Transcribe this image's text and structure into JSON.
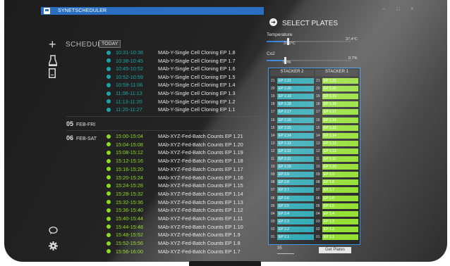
{
  "window": {
    "title": "SYNETSCHEDULER",
    "controls": [
      "–",
      "□",
      "×"
    ]
  },
  "schedule": {
    "heading": "SCHEDULE",
    "today_label": "TODAY"
  },
  "colors": {
    "teal": "#1aa6a6",
    "green": "#8ddc1f",
    "blue": "#2a6fc2",
    "teal_cell": "#1fa3b0",
    "green_cell": "#8ede2a"
  },
  "icons": [
    "plus-icon",
    "flask-icon",
    "tablet-icon",
    "chat-icon",
    "gear-icon"
  ],
  "rows_top": [
    {
      "time": "10:31-10:38",
      "name": "MAb-Y-Single Cell Cloning  EP 1.8"
    },
    {
      "time": "10:38-10:45",
      "name": "MAb-Y-Single Cell Cloning  EP 1.7"
    },
    {
      "time": "10:45-10:52",
      "name": "MAb-Y-Single Cell Cloning  EP 1.6"
    },
    {
      "time": "10:52-10:59",
      "name": "MAb-Y-Single Cell Cloning  EP 1.5"
    },
    {
      "time": "10:59-11:06",
      "name": "MAb-Y-Single Cell Cloning  EP 1.4"
    },
    {
      "time": "11:06-11:13",
      "name": "MAb-Y-Single Cell Cloning  EP 1.3"
    },
    {
      "time": "11:13-11:20",
      "name": "MAb-Y-Single Cell Cloning  EP 1.2"
    },
    {
      "time": "11:20-11:27",
      "name": "MAb-Y-Single Cell Cloning  EP 1.1"
    }
  ],
  "days": [
    {
      "num": "05",
      "label": "FEB-FRI"
    },
    {
      "num": "06",
      "label": "FEB-SAT"
    }
  ],
  "rows_bottom": [
    {
      "time": "15:00-15:04",
      "name": "MAb-XYZ-Fed-Batch Counts  EP 1.21"
    },
    {
      "time": "15:04-15:08",
      "name": "MAb-XYZ-Fed-Batch Counts  EP 1.20"
    },
    {
      "time": "15:08-15:12",
      "name": "MAb-XYZ-Fed-Batch Counts  EP 1.19"
    },
    {
      "time": "15:12-15:16",
      "name": "MAb-XYZ-Fed-Batch Counts  EP 1.18"
    },
    {
      "time": "15:16-15:20",
      "name": "MAb-XYZ-Fed-Batch Counts  EP 1.17"
    },
    {
      "time": "15:20-15:24",
      "name": "MAb-XYZ-Fed-Batch Counts  EP 1.16"
    },
    {
      "time": "15:24-15:28",
      "name": "MAb-XYZ-Fed-Batch Counts  EP 1.15"
    },
    {
      "time": "15:28-15:32",
      "name": "MAb-XYZ-Fed-Batch Counts  EP 1.14"
    },
    {
      "time": "15:32-15:36",
      "name": "MAb-XYZ-Fed-Batch Counts  EP 1.13"
    },
    {
      "time": "15:36-15:40",
      "name": "MAb-XYZ-Fed-Batch Counts  EP 1.12"
    },
    {
      "time": "15:40-15:44",
      "name": "MAb-XYZ-Fed-Batch Counts  EP 1.11"
    },
    {
      "time": "15:44-15:48",
      "name": "MAb-XYZ-Fed-Batch Counts  EP 1.10"
    },
    {
      "time": "15:48-15:52",
      "name": "MAb-XYZ-Fed-Batch Counts  EP 1.9"
    },
    {
      "time": "15:52-15:56",
      "name": "MAb-XYZ-Fed-Batch Counts  EP 1.8"
    },
    {
      "time": "15:56-16:00",
      "name": "MAb-XYZ-Fed-Batch Counts  EP 1.7"
    }
  ],
  "panel": {
    "title": "SELECT PLATES",
    "temperature": {
      "label": "Temperature",
      "value": "37.0°C",
      "max": "37.4°C",
      "level": 0.25
    },
    "co2": {
      "label": "Co2",
      "value": "7.0%",
      "max": "0.7%",
      "level": 0.22
    },
    "stacker2_label": "STACKER 2",
    "stacker1_label": "STACKER 1",
    "stacker2": [
      {
        "n": "21",
        "p": "EP 2.21"
      },
      {
        "n": "20",
        "p": "EP 2.20"
      },
      {
        "n": "19",
        "p": "EP 2.19"
      },
      {
        "n": "18",
        "p": "EP 2.18"
      },
      {
        "n": "17",
        "p": "EP 2.17"
      },
      {
        "n": "16",
        "p": "EP 2.16"
      },
      {
        "n": "15",
        "p": "EP 2.15"
      },
      {
        "n": "14",
        "p": "EP 2.14"
      },
      {
        "n": "13",
        "p": "EP 2.13"
      },
      {
        "n": "12",
        "p": "EP 2.12"
      },
      {
        "n": "11",
        "p": "EP 2.11"
      },
      {
        "n": "10",
        "p": "EP 2.10"
      },
      {
        "n": "09",
        "p": "EP 2.9"
      },
      {
        "n": "08",
        "p": "EP 2.8"
      },
      {
        "n": "07",
        "p": "EP 2.7"
      },
      {
        "n": "06",
        "p": "EP 2.6"
      },
      {
        "n": "05",
        "p": "EP 2.5"
      },
      {
        "n": "04",
        "p": "EP 2.4"
      },
      {
        "n": "03",
        "p": "EP 2.3"
      },
      {
        "n": "02",
        "p": "EP 2.2"
      },
      {
        "n": "01",
        "p": "EP 2.1"
      }
    ],
    "stacker1": [
      {
        "n": "21",
        "p": "EP 1.21"
      },
      {
        "n": "20",
        "p": "EP 1.20"
      },
      {
        "n": "19",
        "p": "EP 1.19"
      },
      {
        "n": "18",
        "p": "EP 1.18"
      },
      {
        "n": "17",
        "p": "EP 1.17"
      },
      {
        "n": "16",
        "p": "EP 1.16"
      },
      {
        "n": "15",
        "p": "EP 1.15"
      },
      {
        "n": "14",
        "p": "EP 1.14"
      },
      {
        "n": "13",
        "p": "EP 1.13"
      },
      {
        "n": "12",
        "p": "EP 1.12"
      },
      {
        "n": "11",
        "p": "EP 1.11"
      },
      {
        "n": "10",
        "p": "EP 1.10"
      },
      {
        "n": "09",
        "p": "EP 1.9"
      },
      {
        "n": "08",
        "p": "EP 1.8"
      },
      {
        "n": "07",
        "p": "EP 1.7"
      },
      {
        "n": "06",
        "p": "EP 1.6"
      },
      {
        "n": "05",
        "p": "EP 1.5"
      },
      {
        "n": "04",
        "p": "EP 1.4"
      },
      {
        "n": "03",
        "p": "EP 1.3"
      },
      {
        "n": "02",
        "p": "EP 1.2"
      },
      {
        "n": "01",
        "p": "EP 1.1"
      }
    ],
    "bottom_input": "35",
    "bottom_button": "Get Plates"
  }
}
